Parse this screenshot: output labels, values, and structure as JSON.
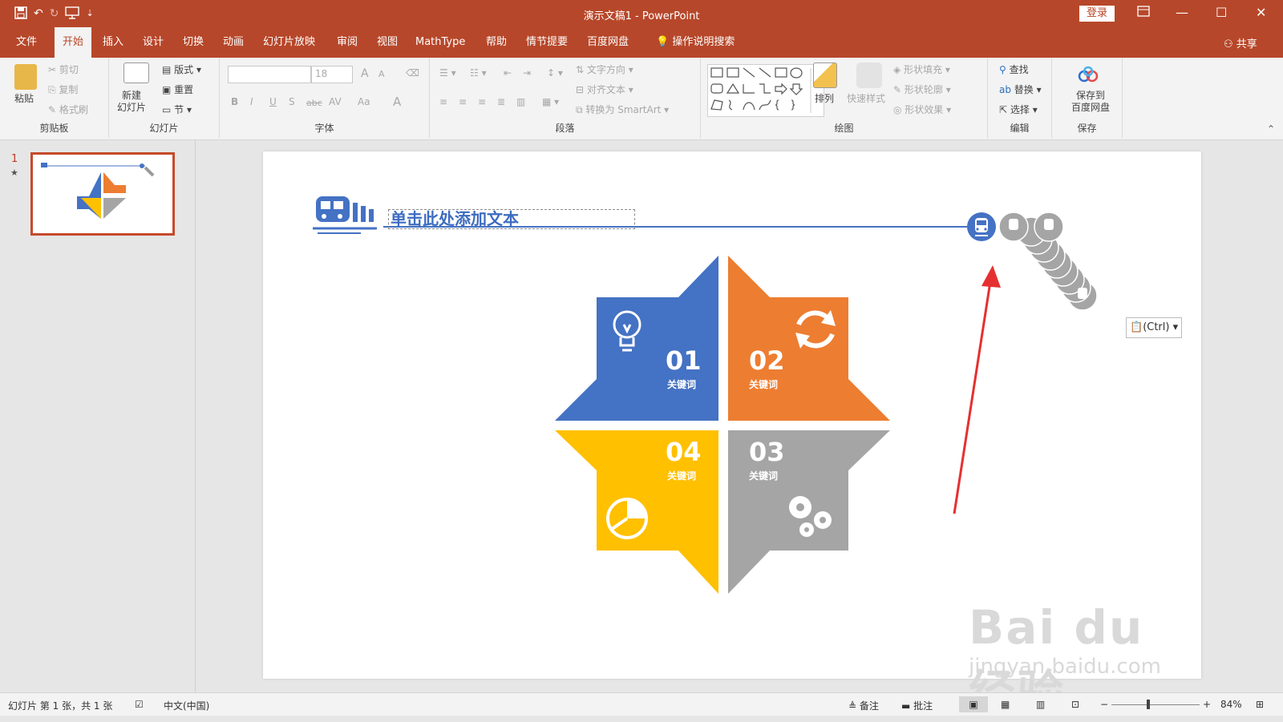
{
  "titlebar": {
    "doc_title": "演示文稿1 - PowerPoint",
    "login": "登录",
    "qat_customize": "⇣"
  },
  "tabs": [
    {
      "label": "文件"
    },
    {
      "label": "开始"
    },
    {
      "label": "插入"
    },
    {
      "label": "设计"
    },
    {
      "label": "切换"
    },
    {
      "label": "动画"
    },
    {
      "label": "幻灯片放映"
    },
    {
      "label": "审阅"
    },
    {
      "label": "视图"
    },
    {
      "label": "MathType"
    },
    {
      "label": "帮助"
    },
    {
      "label": "情节提要"
    },
    {
      "label": "百度网盘"
    },
    {
      "label": "操作说明搜索"
    }
  ],
  "share": "共享",
  "ribbon": {
    "clipboard": {
      "paste": "粘贴",
      "cut": "剪切",
      "copy": "复制",
      "format_painter": "格式刷",
      "label": "剪贴板"
    },
    "slides": {
      "new_slide": "新建\n幻灯片",
      "layout": "版式",
      "reset": "重置",
      "section": "节",
      "label": "幻灯片"
    },
    "font": {
      "font_size": "18",
      "bold": "B",
      "italic": "I",
      "underline": "U",
      "shadow": "S",
      "strike": "abc",
      "spacing": "AV",
      "case": "Aa",
      "color": "A",
      "grow": "A",
      "shrink": "A",
      "label": "字体"
    },
    "paragraph": {
      "text_direction": "文字方向",
      "align_text": "对齐文本",
      "smartart": "转换为 SmartArt",
      "label": "段落"
    },
    "drawing": {
      "arrange": "排列",
      "quick_styles": "快速样式",
      "shape_fill": "形状填充",
      "shape_outline": "形状轮廓",
      "shape_effects": "形状效果",
      "label": "绘图"
    },
    "editing": {
      "find": "查找",
      "replace": "替换",
      "select": "选择",
      "label": "编辑"
    },
    "save": {
      "save_to": "保存到\n百度网盘",
      "label": "保存"
    }
  },
  "slide_panel": {
    "number": "1",
    "star": "★"
  },
  "slide": {
    "placeholder": "单击此处添加文本",
    "quadrants": [
      {
        "num": "01",
        "keyword": "关键词",
        "color": "#4472c4"
      },
      {
        "num": "02",
        "keyword": "关键词",
        "color": "#ed7d31"
      },
      {
        "num": "03",
        "keyword": "关键词",
        "color": "#a5a5a5"
      },
      {
        "num": "04",
        "keyword": "关键词",
        "color": "#ffc000"
      }
    ]
  },
  "paste_options": "(Ctrl)",
  "watermark": {
    "brand": "Bai du 经验",
    "url": "jingyan.baidu.com"
  },
  "statusbar": {
    "slide_info": "幻灯片 第 1 张，共 1 张",
    "language": "中文(中国)",
    "notes": "备注",
    "comments": "批注",
    "zoom": "84%"
  },
  "colors": {
    "accent": "#b7472a",
    "arrow": "#e63030"
  }
}
